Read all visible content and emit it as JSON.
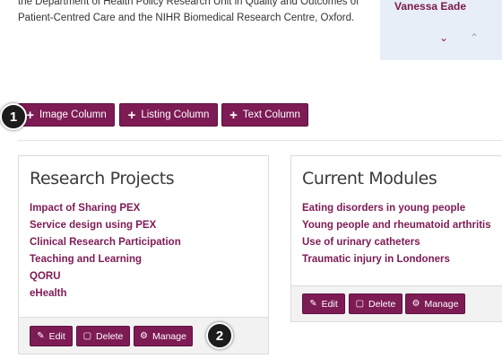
{
  "intro": {
    "line1": "the Department of Health Policy Research Unit in Quality and Outcomes of",
    "line2": "Patient-Centred Care and the NIHR Biomedical Research Centre, Oxford."
  },
  "side_panel": {
    "name": "Vanessa Eade"
  },
  "add_buttons": {
    "image": "Image Column",
    "listing": "Listing Column",
    "text": "Text Column"
  },
  "callouts": {
    "first": "1",
    "second": "2"
  },
  "cards": [
    {
      "title": "Research Projects",
      "items": [
        "Impact of Sharing PEX",
        "Service design using PEX",
        "Clinical Research Participation",
        "Teaching and Learning",
        "QORU",
        "eHealth"
      ]
    },
    {
      "title": "Current Modules",
      "items": [
        "Eating disorders in young people",
        "Young people and rheumatoid arthritis",
        "Use of urinary catheters",
        "Traumatic injury in Londoners"
      ]
    }
  ],
  "card_actions": {
    "edit": "Edit",
    "delete": "Delete",
    "manage": "Manage"
  },
  "icons": {
    "plus": "plus-icon",
    "edit": "pencil-icon",
    "delete": "trash-icon",
    "manage": "gear-icon",
    "expand": "chevron-down-icon",
    "collapse": "chevron-up-icon"
  },
  "colors": {
    "accent": "#7d1b55",
    "link": "#7d1b55",
    "panel_bg": "#e8eef7",
    "footer_bg": "#f2f2f2",
    "callout_bg": "#1c1c1c"
  }
}
